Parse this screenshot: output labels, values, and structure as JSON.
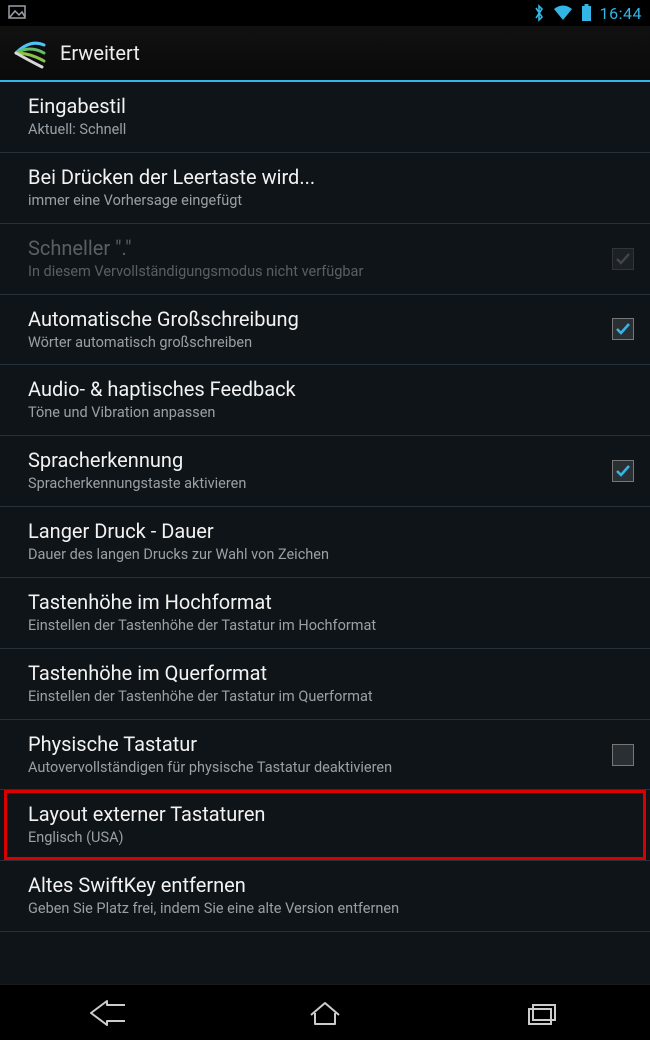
{
  "status": {
    "clock": "16:44"
  },
  "header": {
    "title": "Erweitert"
  },
  "items": [
    {
      "title": "Eingabestil",
      "sub": "Aktuell: Schnell"
    },
    {
      "title": "Bei Drücken der Leertaste wird...",
      "sub": "immer eine Vorhersage eingefügt"
    },
    {
      "title": "Schneller \".\"",
      "sub": "In diesem Vervollständigungsmodus nicht verfügbar"
    },
    {
      "title": "Automatische Großschreibung",
      "sub": "Wörter automatisch großschreiben"
    },
    {
      "title": "Audio- & haptisches Feedback",
      "sub": "Töne und Vibration anpassen"
    },
    {
      "title": "Spracherkennung",
      "sub": "Spracherkennungstaste aktivieren"
    },
    {
      "title": "Langer Druck - Dauer",
      "sub": "Dauer des langen Drucks zur Wahl von Zeichen"
    },
    {
      "title": "Tastenhöhe im Hochformat",
      "sub": "Einstellen der Tastenhöhe der Tastatur im Hochformat"
    },
    {
      "title": "Tastenhöhe im Querformat",
      "sub": "Einstellen der Tastenhöhe der Tastatur im Querformat"
    },
    {
      "title": "Physische Tastatur",
      "sub": "Autovervollständigen für physische Tastatur deaktivieren"
    },
    {
      "title": "Layout externer Tastaturen",
      "sub": "Englisch (USA)"
    },
    {
      "title": "Altes SwiftKey entfernen",
      "sub": "Geben Sie Platz frei, indem Sie eine alte Version entfernen"
    }
  ]
}
